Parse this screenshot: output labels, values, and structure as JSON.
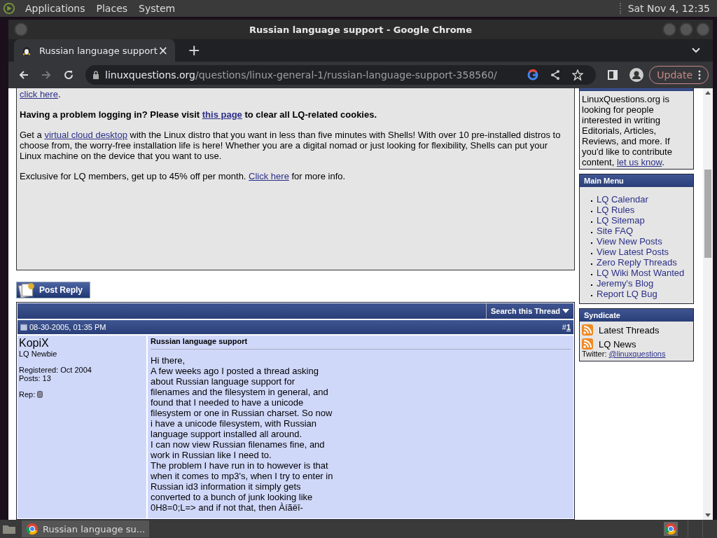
{
  "top_panel": {
    "menus": [
      "Applications",
      "Places",
      "System"
    ],
    "clock": "Sat Nov 4, 12:35"
  },
  "window": {
    "title": "Russian language support - Google Chrome"
  },
  "tabs": [
    {
      "label": "Russian language support",
      "close": "×",
      "selected": true
    }
  ],
  "new_tab": "+",
  "address_bar": {
    "host": "linuxquestions.org",
    "path": "/questions/linux-general-1/russian-language-support-358560/"
  },
  "update_button": "Update",
  "notice": {
    "cut_link": "click here",
    "cut_after": ".",
    "login": {
      "before": "Having a problem logging in? Please visit ",
      "link": "this page",
      "after": " to clear all LQ-related cookies."
    },
    "shells": {
      "before": "Get a ",
      "link": "virtual cloud desktop",
      "after": " with the Linux distro that you want in less than five minutes with Shells! With over 10 pre-installed distros to choose from, the worry-free installation life is here! Whether you are a digital nomad or just looking for flexibility, Shells can put your Linux machine on the device that you want to use."
    },
    "offer": {
      "before": "Exclusive for LQ members, get up to 45% off per month. ",
      "link": "Click here",
      "after": " for more info."
    }
  },
  "post_reply": "Post Reply",
  "thread_tools": "Search this Thread",
  "post": {
    "date": "08-30-2005, 01:35 PM",
    "number_prefix": "#",
    "number": "1",
    "author": "KopiX",
    "rank": "LQ Newbie",
    "registered": "Registered: Oct 2004",
    "posts": "Posts: 13",
    "rep": "Rep:",
    "title": "Russian language support",
    "body": [
      "Hi there,",
      "A few weeks ago I posted a thread asking about Russian language support for filenames and the filesystem in general, and found that I needed to have a unicode filesystem or one in Russian charset. So now i have a unicode filesystem, with Russian language support installed all around.",
      "I can now view Russian filenames fine, and work in Russian like I need to.",
      "The problem I have run in to however is that when it comes to mp3's, when I try to enter in Russian id3 information it simply gets converted to a bunch of junk looking like 0H8=0;L=> and if not that, then Àíãëî-"
    ]
  },
  "sidebar": {
    "writers": {
      "before": "LinuxQuestions.org is looking for people interested in writing Editorials, Articles, Reviews, and more. If you'd like to contribute content, ",
      "link": "let us know",
      "after": "."
    },
    "main_menu": {
      "title": "Main Menu",
      "items": [
        "LQ Calendar",
        "LQ Rules",
        "LQ Sitemap",
        "Site FAQ",
        "View New Posts",
        "View Latest Posts",
        "Zero Reply Threads",
        "LQ Wiki Most Wanted",
        "Jeremy's Blog",
        "Report LQ Bug"
      ]
    },
    "syndicate": {
      "title": "Syndicate",
      "feeds": [
        "Latest Threads",
        "LQ News"
      ],
      "twitter_label": "Twitter: ",
      "twitter": "@linuxquestions"
    }
  },
  "taskbar": {
    "task": "Russian language su..."
  }
}
